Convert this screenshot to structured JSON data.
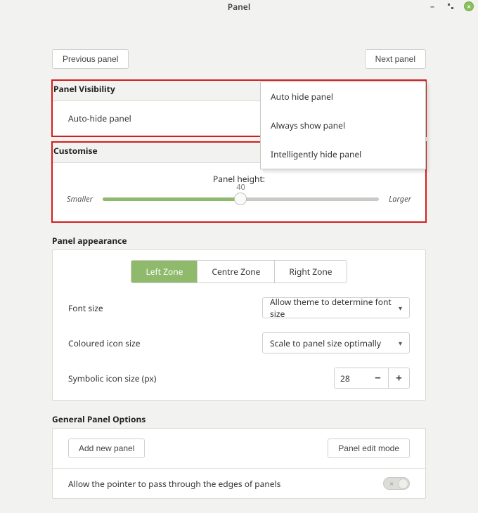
{
  "window": {
    "title": "Panel"
  },
  "nav": {
    "prev": "Previous panel",
    "next": "Next panel"
  },
  "visibility": {
    "heading": "Panel Visibility",
    "row_label": "Auto-hide panel",
    "options": {
      "o0": "Auto hide panel",
      "o1": "Always show panel",
      "o2": "Intelligently hide panel"
    }
  },
  "customise": {
    "heading": "Customise",
    "height_label": "Panel height:",
    "smaller": "Smaller",
    "larger": "Larger",
    "value": "40",
    "min": 0,
    "max": 100
  },
  "appearance": {
    "heading": "Panel appearance",
    "zones": {
      "left": "Left Zone",
      "centre": "Centre Zone",
      "right": "Right Zone",
      "active": "left"
    },
    "fields": {
      "font_size_label": "Font size",
      "font_size_value": "Allow theme to determine font size",
      "coloured_icon_label": "Coloured icon size",
      "coloured_icon_value": "Scale to panel size optimally",
      "symbolic_label": "Symbolic icon size (px)",
      "symbolic_value": "28"
    }
  },
  "general": {
    "heading": "General Panel Options",
    "add_panel": "Add new panel",
    "edit_mode": "Panel edit mode",
    "pass_through": "Allow the pointer to pass through the edges of panels",
    "pass_through_on": false
  }
}
